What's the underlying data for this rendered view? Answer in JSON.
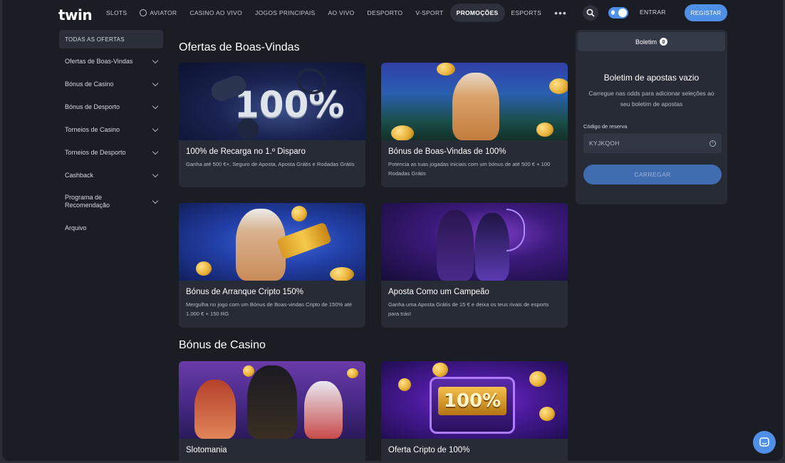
{
  "header": {
    "logo": "twin",
    "nav": [
      "SLOTS",
      "AVIATOR",
      "CASINO AO VIVO",
      "JOGOS PRINCIPAIS",
      "AO VIVO",
      "DESPORTO",
      "V-SPORT",
      "PROMOÇÕES",
      "ESPORTS"
    ],
    "active_nav": "PROMOÇÕES",
    "more": "•••",
    "login_label": "ENTRAR",
    "register_label": "REGISTAR"
  },
  "sidebar": {
    "items": [
      {
        "label": "TODAS AS OFERTAS"
      },
      {
        "label": "Ofertas de Boas-Vindas"
      },
      {
        "label": "Bónus de Casino"
      },
      {
        "label": "Bónus de Desporto"
      },
      {
        "label": "Torneios de Casino"
      },
      {
        "label": "Torneios de Desporto"
      },
      {
        "label": "Cashback"
      },
      {
        "label": "Programa de Recomendação"
      },
      {
        "label": "Arquivo"
      }
    ]
  },
  "sections": [
    {
      "title": "Ofertas de Boas-Vindas",
      "cards": [
        {
          "title": "100% de Recarga no 1.º Disparo",
          "desc": "Ganha até 500 €+, Seguro de Aposta, Aposta Grátis e Rodadas Grátis",
          "image_text": "100%"
        },
        {
          "title": "Bónus de Boas-Vindas de 100%",
          "desc": "Potencia as tuas jogadas iniciais com um bónus de até 500 € + 100 Rodadas Grátis"
        },
        {
          "title": "Bónus de Arranque Cripto 150%",
          "desc": "Mergulha no jogo com um Bónus de Boas-vindas Cripto de 150% até 1.000 € + 150 RG"
        },
        {
          "title": "Aposta Como um Campeão",
          "desc": "Ganha uma Aposta Grátis de 15 € e deixa os teus rivais de esports para trás!"
        }
      ]
    },
    {
      "title": "Bónus de Casino",
      "cards": [
        {
          "title": "Slotomania",
          "desc": ""
        },
        {
          "title": "Oferta Cripto de 100%",
          "desc": "",
          "image_text": "100%"
        }
      ]
    }
  ],
  "betslip": {
    "tab_label": "Boletim",
    "count": "0",
    "empty_title": "Boletim de apostas vazio",
    "empty_sub": "Carregue nas odds para adicionar seleções ao seu boletim de apostas",
    "code_label": "Código de reserva",
    "code_value": "KYJKQOH",
    "load_label": "CARREGAR"
  },
  "colors": {
    "accent": "#4f8fe6",
    "background": "#1a1d24",
    "card": "#262b35"
  }
}
